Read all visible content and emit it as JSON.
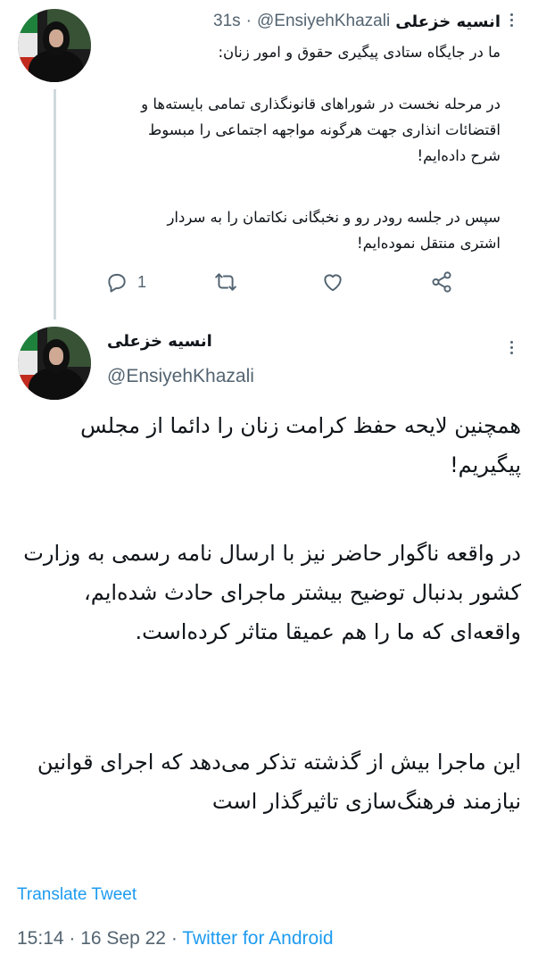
{
  "tweet1": {
    "display_name": "انسیه خزعلی",
    "handle": "@EnsiyehKhazali",
    "separator": "·",
    "time": "31s",
    "paragraphs": [
      "ما در جایگاه ستادی پیگیری حقوق و امور زنان:",
      "در مرحله نخست در شوراهای قانونگذاری تمامی بایسته‌ها و اقتضائات انذاری جهت هرگونه مواجهه اجتماعی را مبسوط شرح داده‌ایم!",
      "سپس در جلسه رودر رو و نخبگانی نکاتمان را به سردار اشتری منتقل نموده‌ایم!"
    ],
    "actions": {
      "reply_count": "1",
      "retweet_count": "",
      "like_count": ""
    },
    "icons": {
      "reply": "reply-icon",
      "retweet": "retweet-icon",
      "like": "heart-icon",
      "share": "share-icon",
      "more": "more-icon"
    }
  },
  "tweet2": {
    "display_name": "انسیه خزعلی",
    "handle": "@EnsiyehKhazali",
    "paragraphs": [
      "همچنین لایحه حفظ کرامت زنان را دائما از مجلس پیگیریم!",
      "در واقعه ناگوار حاضر نیز با ارسال نامه رسمی به وزارت کشور بدنبال توضیح بیشتر ماجرای حادث شده‌ایم، واقعه‌ای که ما را هم عمیقا متاثر کرده‌است.",
      "این ماجرا بیش از گذشته تذکر می‌دهد که اجرای قوانین نیازمند فرهنگ‌سازی تاثیرگذار است"
    ],
    "translate_label": "Translate Tweet",
    "footer": {
      "time": "15:14",
      "sep1": " · ",
      "date": "16 Sep 22",
      "sep2": " · ",
      "source": "Twitter for Android"
    }
  },
  "colors": {
    "text": "#0f1419",
    "secondary": "#536471",
    "link": "#1d9bf0",
    "thread_line": "#cfd9de"
  }
}
